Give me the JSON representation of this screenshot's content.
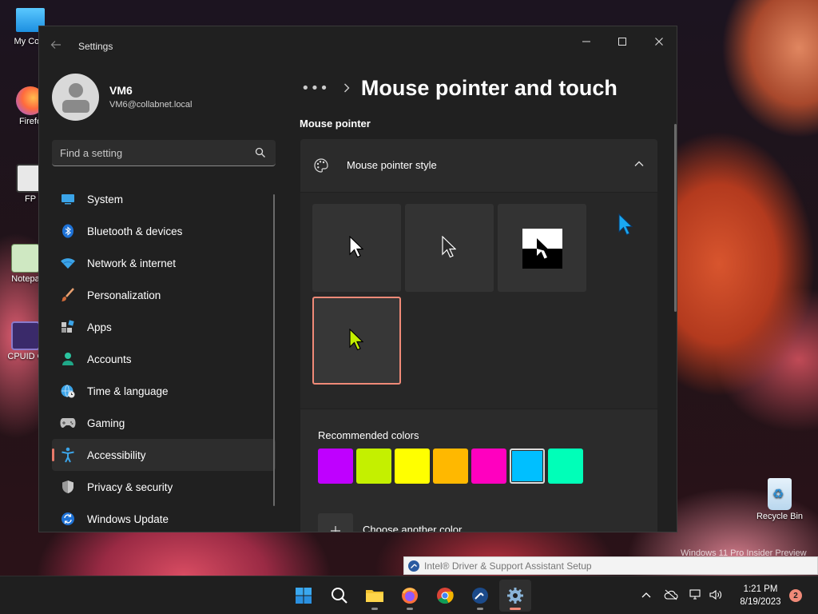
{
  "desktop": {
    "icons": [
      {
        "label": "My Com",
        "icon": "monitor-icon"
      },
      {
        "label": "Firefo",
        "icon": "firefox-icon"
      },
      {
        "label": "FP",
        "icon": "app-shortcut-icon"
      },
      {
        "label": "Notepa",
        "icon": "notepad-icon"
      },
      {
        "label": "CPUID C",
        "icon": "cpuid-icon"
      }
    ],
    "recycle_bin_label": "Recycle Bin",
    "watermark": "Windows 11 Pro Insider Preview"
  },
  "window": {
    "title": "Settings",
    "controls": {
      "minimize": "─",
      "maximize": "☐",
      "close": "✕"
    },
    "accent_color": "#f08a78"
  },
  "profile": {
    "name": "VM6",
    "email": "VM6@collabnet.local"
  },
  "search": {
    "placeholder": "Find a setting"
  },
  "sidebar": {
    "items": [
      {
        "label": "System",
        "icon": "system-icon"
      },
      {
        "label": "Bluetooth & devices",
        "icon": "bluetooth-icon"
      },
      {
        "label": "Network & internet",
        "icon": "network-icon"
      },
      {
        "label": "Personalization",
        "icon": "brush-icon"
      },
      {
        "label": "Apps",
        "icon": "apps-icon"
      },
      {
        "label": "Accounts",
        "icon": "accounts-icon"
      },
      {
        "label": "Time & language",
        "icon": "globe-clock-icon"
      },
      {
        "label": "Gaming",
        "icon": "gamepad-icon"
      },
      {
        "label": "Accessibility",
        "icon": "accessibility-icon",
        "selected": true
      },
      {
        "label": "Privacy & security",
        "icon": "shield-icon"
      },
      {
        "label": "Windows Update",
        "icon": "update-icon"
      }
    ]
  },
  "main": {
    "breadcrumb_more": "•••",
    "page_title": "Mouse pointer and touch",
    "section_label": "Mouse pointer",
    "pointer_style": {
      "label": "Mouse pointer style",
      "options": [
        "white",
        "black",
        "inverted",
        "custom"
      ],
      "selected": "custom"
    },
    "colors": {
      "label": "Recommended colors",
      "swatches": [
        "#bf00ff",
        "#c4f000",
        "#ffff00",
        "#ffb800",
        "#ff00bf",
        "#00bfff",
        "#00ffb8"
      ],
      "selected_index": 5,
      "choose_label": "Choose another color"
    }
  },
  "toast": {
    "text": "Intel® Driver & Support Assistant Setup"
  },
  "taskbar": {
    "apps": [
      "start-icon",
      "search-icon",
      "file-explorer-icon",
      "firefox-icon",
      "chrome-icon",
      "driver-assistant-icon",
      "settings-icon"
    ],
    "time": "1:21 PM",
    "date": "8/19/2023",
    "notification_count": "2"
  }
}
